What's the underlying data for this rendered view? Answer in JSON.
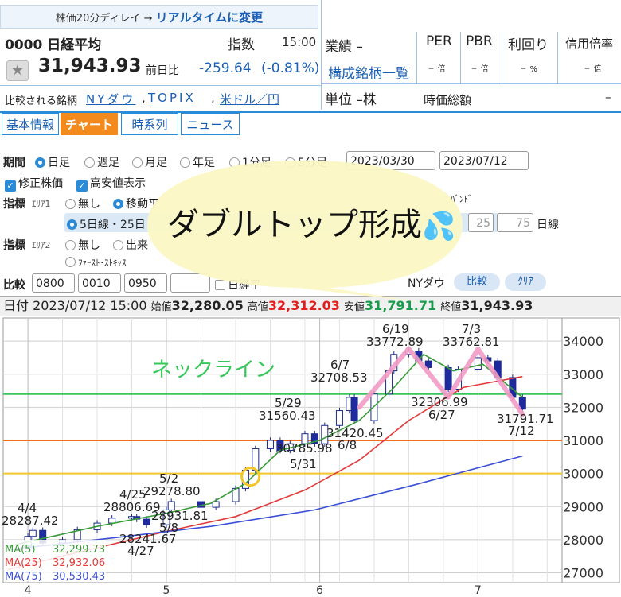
{
  "delay": {
    "text": "株価20分ディレイ → ",
    "link": "リアルタイムに変更"
  },
  "quote": {
    "code_name": "0000 日経平均",
    "kind": "指数",
    "time": "15:00",
    "price": "31,943.93",
    "change_label": "前日比",
    "change": "-259.64",
    "change_pct": "(-0.81%)",
    "compare_label": "比較される銘柄",
    "compare_links": [
      "NYダウ",
      "TOPIX",
      "米ドル／円"
    ],
    "sector_label": "業績 –",
    "constituents_link": "構成銘柄一覧",
    "unit_label": "単位 –株",
    "market_cap_label": "時価総額",
    "market_cap_value": "–",
    "metrics": [
      {
        "label": "PER",
        "value": "–",
        "unit": "倍"
      },
      {
        "label": "PBR",
        "value": "–",
        "unit": "倍"
      },
      {
        "label": "利回り",
        "value": "–",
        "unit": "%"
      },
      {
        "label": "信用倍率",
        "value": "–",
        "unit": "倍"
      }
    ]
  },
  "tabs": [
    "基本情報",
    "チャート",
    "時系列",
    "ニュース"
  ],
  "controls": {
    "period_label": "期間",
    "period_options": [
      "日足",
      "週足",
      "月足",
      "年足",
      "1分足",
      "5分足"
    ],
    "date_from": "2023/03/30",
    "date_to": "2023/07/12",
    "adjusted": "修正株価",
    "high_low": "高安値表示",
    "indicator_label": "指標",
    "area1": "ｴﾘｱ1",
    "area2": "ｴﾘｱ2",
    "none": "無し",
    "moving_avg": "移動平",
    "bollinger": "ﾊﾞﾝﾄﾞ",
    "ma_periods": "5日線・25日",
    "ma_input_1": "25",
    "ma_input_2": "75",
    "ma_unit": "日線",
    "volume": "出来",
    "first_stochastics": "ﾌｧｰｽﾄ･ｽﾄｷｬｽ",
    "compare_label": "比較",
    "compare_codes": [
      "0800",
      "0010",
      "0950",
      ""
    ],
    "nikkei_check": "日経平",
    "nydow": "NYダウ",
    "compare_button": "比較",
    "clear_button": "ｸﾘｱ"
  },
  "ohlc_bar": {
    "date_label": "日付",
    "date": "2023/07/12 15:00",
    "open_label": "始値",
    "open": "32,280.05",
    "high_label": "高値",
    "high": "32,312.03",
    "low_label": "安値",
    "low": "31,791.71",
    "close_label": "終値",
    "close": "31,943.93"
  },
  "annotation": {
    "bubble_text": "ダブルトップ形成",
    "neckline_label": "ネックライン"
  },
  "chart_data": {
    "type": "line",
    "title": "",
    "ylim": [
      26700,
      34700
    ],
    "y_ticks": [
      27000,
      28000,
      29000,
      30000,
      31000,
      32000,
      33000,
      34000
    ],
    "x_ticks": [
      "4",
      "5",
      "6",
      "7"
    ],
    "x_tick_dates": [
      "2023-04-03",
      "2023-05-01",
      "2023-06-01",
      "2023-07-03"
    ],
    "x_range": [
      "2023-03-30",
      "2023-07-12"
    ],
    "close_series": {
      "dates": [
        "2023-03-30",
        "2023-04-03",
        "2023-04-04",
        "2023-04-06",
        "2023-04-10",
        "2023-04-13",
        "2023-04-17",
        "2023-04-20",
        "2023-04-24",
        "2023-04-25",
        "2023-04-27",
        "2023-05-01",
        "2023-05-02",
        "2023-05-08",
        "2023-05-11",
        "2023-05-15",
        "2023-05-17",
        "2023-05-19",
        "2023-05-22",
        "2023-05-24",
        "2023-05-26",
        "2023-05-29",
        "2023-05-31",
        "2023-06-02",
        "2023-06-05",
        "2023-06-07",
        "2023-06-08",
        "2023-06-12",
        "2023-06-15",
        "2023-06-16",
        "2023-06-19",
        "2023-06-21",
        "2023-06-23",
        "2023-06-27",
        "2023-06-29",
        "2023-07-03",
        "2023-07-05",
        "2023-07-07",
        "2023-07-10",
        "2023-07-12"
      ],
      "values": [
        27800,
        28100,
        28280,
        27900,
        28000,
        28300,
        28500,
        28650,
        28700,
        28620,
        28450,
        28900,
        29150,
        28980,
        29150,
        29550,
        30100,
        30750,
        31000,
        30700,
        30900,
        31200,
        30900,
        31450,
        31900,
        32300,
        31600,
        32400,
        33100,
        33600,
        33700,
        33400,
        33200,
        32550,
        33150,
        33500,
        33400,
        32900,
        32300,
        31944
      ]
    },
    "series": [
      {
        "name": "MA(5)",
        "value_label": "32,299.73",
        "color": "#3a9a3a",
        "dates": [
          "2023-03-30",
          "2023-04-17",
          "2023-05-01",
          "2023-05-10",
          "2023-05-17",
          "2023-05-24",
          "2023-06-01",
          "2023-06-09",
          "2023-06-16",
          "2023-06-22",
          "2023-06-28",
          "2023-07-04",
          "2023-07-12"
        ],
        "values": [
          27800,
          28400,
          28800,
          29100,
          29700,
          30700,
          31000,
          31600,
          32600,
          33600,
          33100,
          33300,
          32300
        ]
      },
      {
        "name": "MA(25)",
        "value_label": "32,932.06",
        "color": "#e23a3a",
        "dates": [
          "2023-03-30",
          "2023-04-14",
          "2023-05-01",
          "2023-05-15",
          "2023-05-29",
          "2023-06-09",
          "2023-06-19",
          "2023-06-30",
          "2023-07-12"
        ],
        "values": [
          27100,
          27650,
          28250,
          28700,
          29500,
          30400,
          31600,
          32600,
          32930
        ]
      },
      {
        "name": "MA(75)",
        "value_label": "30,530.43",
        "color": "#3b4fd6",
        "dates": [
          "2023-03-30",
          "2023-04-20",
          "2023-05-10",
          "2023-05-31",
          "2023-06-20",
          "2023-07-12"
        ],
        "values": [
          27700,
          28050,
          28400,
          28900,
          29650,
          30530
        ]
      }
    ],
    "reference_lines": [
      {
        "name": "ネックライン",
        "value": 32400,
        "color": "#35c759"
      },
      {
        "value": 31000,
        "color": "#f07020"
      },
      {
        "value": 30000,
        "color": "#f3c62c"
      }
    ],
    "double_top_path": {
      "dates": [
        "2023-06-09",
        "2023-06-19",
        "2023-06-27",
        "2023-07-03",
        "2023-07-12"
      ],
      "values": [
        32000,
        33772.89,
        32306.99,
        33762.81,
        31791.71
      ]
    },
    "price_labels": [
      {
        "text": "4/4",
        "value": 28287.42
      },
      {
        "text": "28287.42"
      },
      {
        "text": "4/25",
        "value": 28806.69
      },
      {
        "text": "28806.69"
      },
      {
        "text": "5/2",
        "value": 29278.8
      },
      {
        "text": "29278.80"
      },
      {
        "text": "28931.81"
      },
      {
        "text": "5/8"
      },
      {
        "text": "28241.67"
      },
      {
        "text": "4/27"
      },
      {
        "text": "5/29",
        "value": 31560.43
      },
      {
        "text": "31560.43"
      },
      {
        "text": "6/7",
        "value": 32708.53
      },
      {
        "text": "32708.53"
      },
      {
        "text": "31420.45"
      },
      {
        "text": "6/8"
      },
      {
        "text": "30785.98"
      },
      {
        "text": "5/31"
      },
      {
        "text": "6/19",
        "value": 33772.89
      },
      {
        "text": "33772.89"
      },
      {
        "text": "7/3",
        "value": 33762.81
      },
      {
        "text": "33762.81"
      },
      {
        "text": "32306.99"
      },
      {
        "text": "6/27"
      },
      {
        "text": "31791.71"
      },
      {
        "text": "7/12"
      }
    ],
    "highlight_circle_value": 30000
  }
}
